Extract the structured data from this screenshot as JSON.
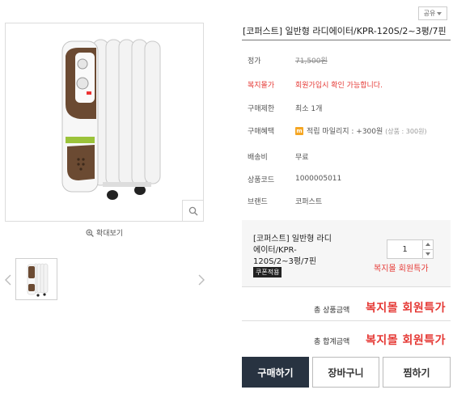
{
  "share": {
    "label": "공유"
  },
  "product": {
    "title": "[코퍼스트] 일반형 라디에이터/KPR-120S/2~3평/7핀"
  },
  "gallery": {
    "enlarge_label": "확대보기"
  },
  "info": {
    "price": {
      "label": "정가",
      "value": "71,500원"
    },
    "welfare_price": {
      "label": "복지몰가",
      "value": "회원가입시 확인 가능합니다."
    },
    "purchase_limit": {
      "label": "구매제한",
      "value": "최소 1개"
    },
    "benefit": {
      "label": "구매혜택",
      "badge": "m",
      "value": "적립 마일리지 : +300원",
      "note": "(상품 : 300원)"
    },
    "shipping": {
      "label": "배송비",
      "value": "무료"
    },
    "product_code": {
      "label": "상품코드",
      "value": "1000005011"
    },
    "brand": {
      "label": "브랜드",
      "value": "코퍼스트"
    }
  },
  "option": {
    "name": "[코퍼스트] 일반형 라디에이터/KPR-120S/2~3평/7핀",
    "coupon_label": "쿠폰적용",
    "quantity": "1",
    "price": "복지몰 회원특가"
  },
  "totals": {
    "product_amount_label": "총 상품금액",
    "product_amount_value": "복지몰 회원특가",
    "grand_total_label": "총 합계금액",
    "grand_total_value": "복지몰 회원특가"
  },
  "actions": {
    "buy_label": "구매하기",
    "cart_label": "장바구니",
    "wish_label": "찜하기"
  },
  "colors": {
    "accent_red": "#e53935",
    "buy_button_bg": "#283341",
    "mileage_badge": "#f5a623"
  }
}
